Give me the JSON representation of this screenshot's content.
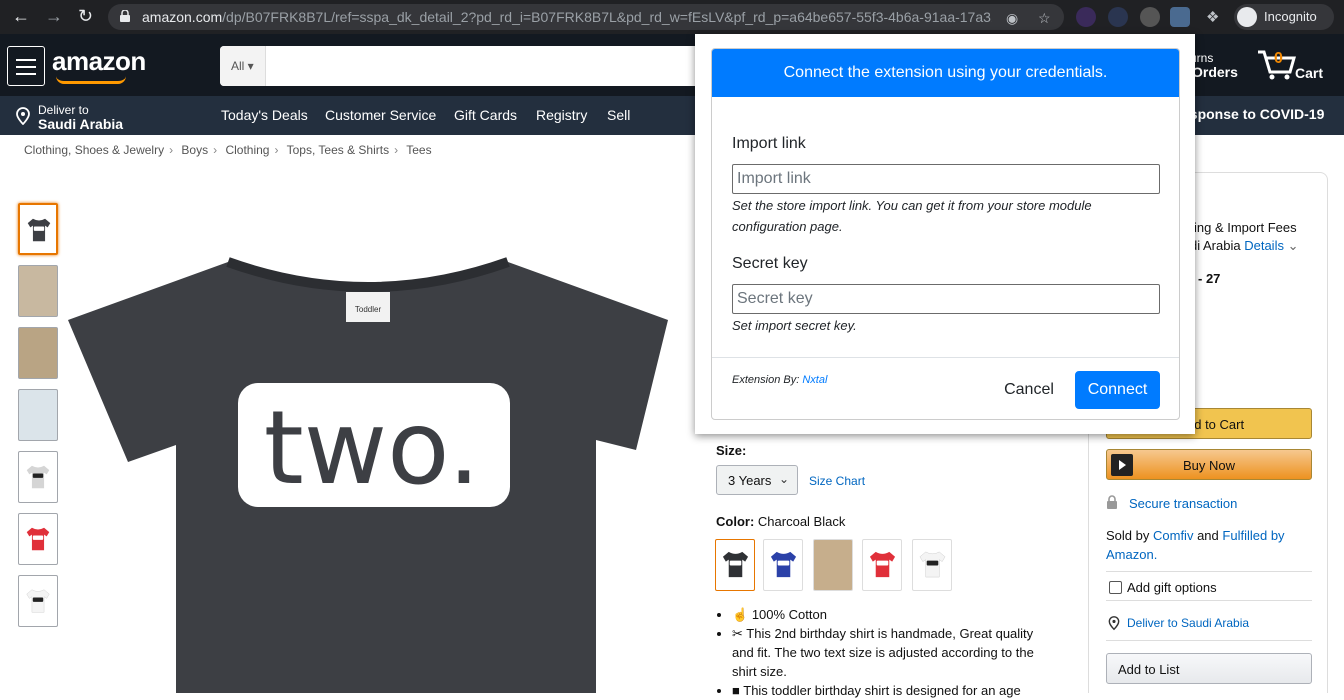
{
  "browser": {
    "url_host": "amazon.com",
    "url_rest": "/dp/B07FRK8B7L/ref=sspa_dk_detail_2?pd_rd_i=B07FRK8B7L&pd_rd_w=fEsLV&pf_rd_p=a64be657-55f3-4b6a-91aa-17a31a...",
    "profile_label": "Incognito"
  },
  "header": {
    "logo": "amazon",
    "search_category": "All",
    "returns_label": "urns",
    "orders_label": "Orders",
    "cart_count": "0",
    "cart_label": "Cart"
  },
  "nav": {
    "deliver_line1": "Deliver to",
    "deliver_line2": "Saudi Arabia",
    "links": [
      "Today's Deals",
      "Customer Service",
      "Gift Cards",
      "Registry",
      "Sell"
    ],
    "covid_banner": "esponse to COVID-19"
  },
  "breadcrumb": [
    "Clothing, Shoes & Jewelry",
    "Boys",
    "Clothing",
    "Tops, Tees & Shirts",
    "Tees"
  ],
  "product": {
    "size_label": "Size:",
    "size_value": "3 Years",
    "size_chart_label": "Size Chart",
    "color_label": "Color:",
    "color_value": "Charcoal Black",
    "bullets": [
      "100% Cotton",
      "This 2nd birthday shirt is handmade, Great quality and fit. The two text size is adjusted according to the shirt size.",
      "This toddler birthday shirt is designed for an age"
    ],
    "shirt_text": "two.",
    "tag_text": "Toddler"
  },
  "buybox": {
    "fees_line1": "ing & Import Fees",
    "fees_line2": "di Arabia",
    "details_link": "Details",
    "date_fragment": "- 27",
    "add_to_cart": "dd to Cart",
    "buy_now": "Buy Now",
    "secure": "Secure transaction",
    "sold_by_prefix": "Sold by",
    "seller": "Comfiv",
    "and": "and",
    "fulfilled_by": "Fulfilled by",
    "amazon": "Amazon.",
    "gift_options": "Add gift options",
    "deliver_to": "Deliver to Saudi Arabia",
    "add_to_list": "Add to List"
  },
  "popup": {
    "header": "Connect the extension using your credentials.",
    "import_label": "Import link",
    "import_placeholder": "Import link",
    "import_help": "Set the store import link. You can get it from your store module configuration page.",
    "secret_label": "Secret key",
    "secret_placeholder": "Secret key",
    "secret_help": "Set import secret key.",
    "byline_prefix": "Extension By:",
    "byline_link": "Nxtal",
    "cancel_label": "Cancel",
    "connect_label": "Connect"
  },
  "colors": {
    "popup_primary": "#007bff",
    "amazon_dark": "#131921",
    "amazon_nav": "#232f3e",
    "amazon_orange": "#ff9900",
    "shirt_charcoal": "#3d3f44"
  }
}
